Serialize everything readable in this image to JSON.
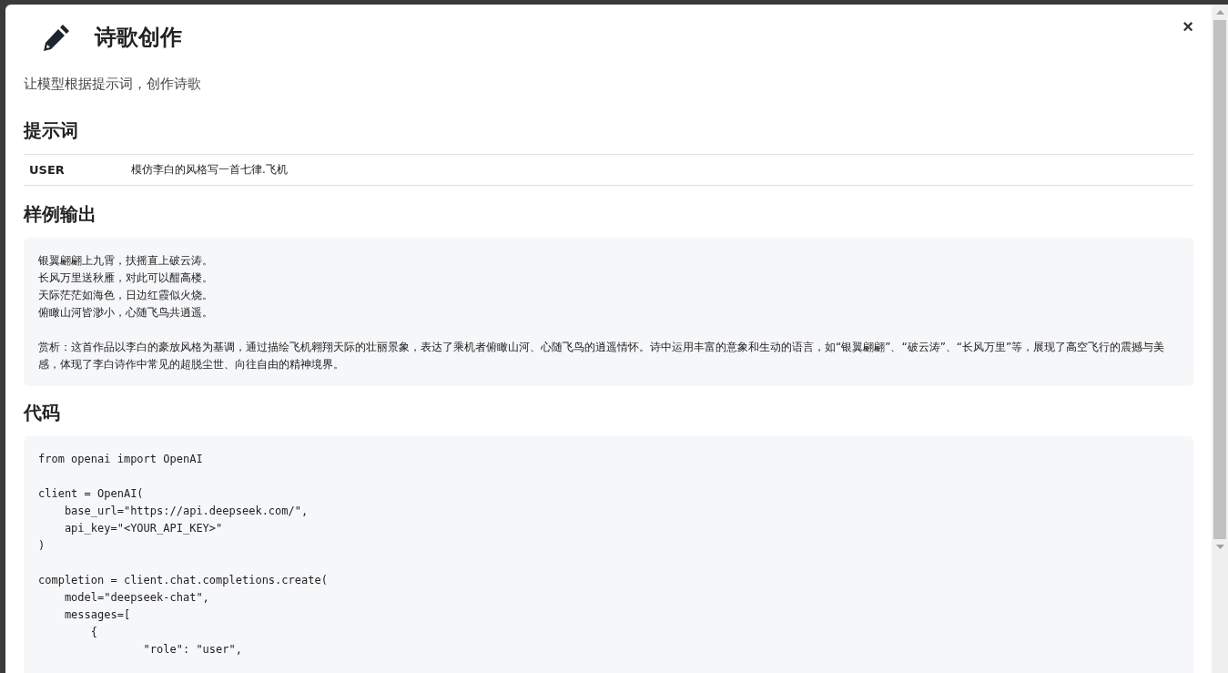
{
  "dialog": {
    "title": "诗歌创作",
    "close": "×",
    "description": "让模型根据提示词，创作诗歌"
  },
  "prompt": {
    "heading": "提示词",
    "rows": [
      {
        "role": "USER",
        "content": "模仿李白的风格写一首七律.飞机"
      }
    ]
  },
  "sample_output": {
    "heading": "样例输出",
    "poem": [
      "银翼翩翩上九霄，扶摇直上破云涛。",
      "长风万里送秋雁，对此可以酣高楼。",
      "天际茫茫如海色，日边红霞似火烧。",
      "俯瞰山河皆渺小，心随飞鸟共逍遥。"
    ],
    "analysis": "赏析：这首作品以李白的豪放风格为基调，通过描绘飞机翱翔天际的壮丽景象，表达了乘机者俯瞰山河、心随飞鸟的逍遥情怀。诗中运用丰富的意象和生动的语言，如“银翼翩翩”、“破云涛”、“长风万里”等，展现了高空飞行的震撼与美感，体现了李白诗作中常见的超脱尘世、向往自由的精神境界。"
  },
  "code": {
    "heading": "代码",
    "blocks": [
      [
        "from openai import OpenAI"
      ],
      [
        "client = OpenAI(",
        "    base_url=\"https://api.deepseek.com/\",",
        "    api_key=\"<YOUR_API_KEY>\"",
        ")"
      ],
      [
        "completion = client.chat.completions.create(",
        "    model=\"deepseek-chat\",",
        "    messages=[",
        "        {",
        "                \"role\": \"user\","
      ]
    ]
  }
}
